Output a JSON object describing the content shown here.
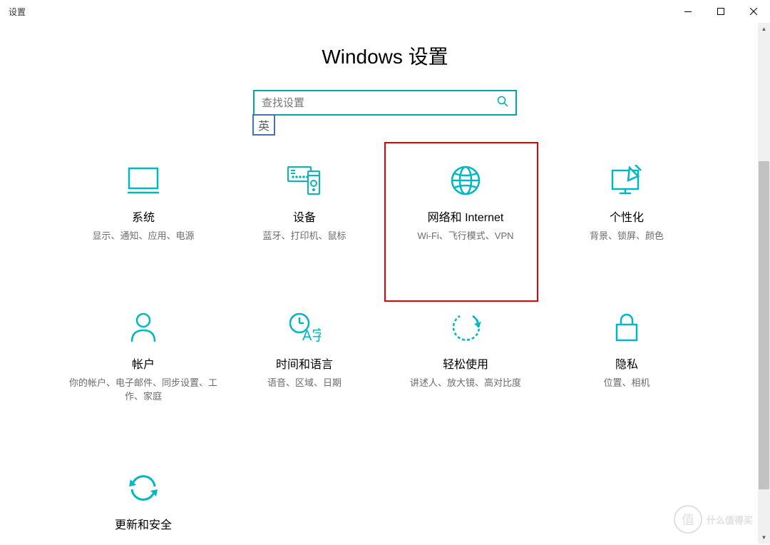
{
  "window": {
    "title": "设置"
  },
  "header": {
    "title": "Windows 设置"
  },
  "search": {
    "placeholder": "查找设置"
  },
  "ime": {
    "label": "英"
  },
  "tiles": [
    {
      "title": "系统",
      "desc": "显示、通知、应用、电源"
    },
    {
      "title": "设备",
      "desc": "蓝牙、打印机、鼠标"
    },
    {
      "title": "网络和 Internet",
      "desc": "Wi-Fi、飞行模式、VPN"
    },
    {
      "title": "个性化",
      "desc": "背景、锁屏、颜色"
    },
    {
      "title": "帐户",
      "desc": "你的帐户、电子邮件、同步设置、工作、家庭"
    },
    {
      "title": "时间和语言",
      "desc": "语音、区域、日期"
    },
    {
      "title": "轻松使用",
      "desc": "讲述人、放大镜、高对比度"
    },
    {
      "title": "隐私",
      "desc": "位置、相机"
    },
    {
      "title": "更新和安全",
      "desc": ""
    }
  ],
  "watermark": {
    "badge": "值",
    "text": "什么值得买"
  },
  "colors": {
    "accent": "#00b7c3",
    "searchBorder": "#00a9a5",
    "highlight": "#e60000",
    "imeBorder": "#4a6fb3"
  }
}
